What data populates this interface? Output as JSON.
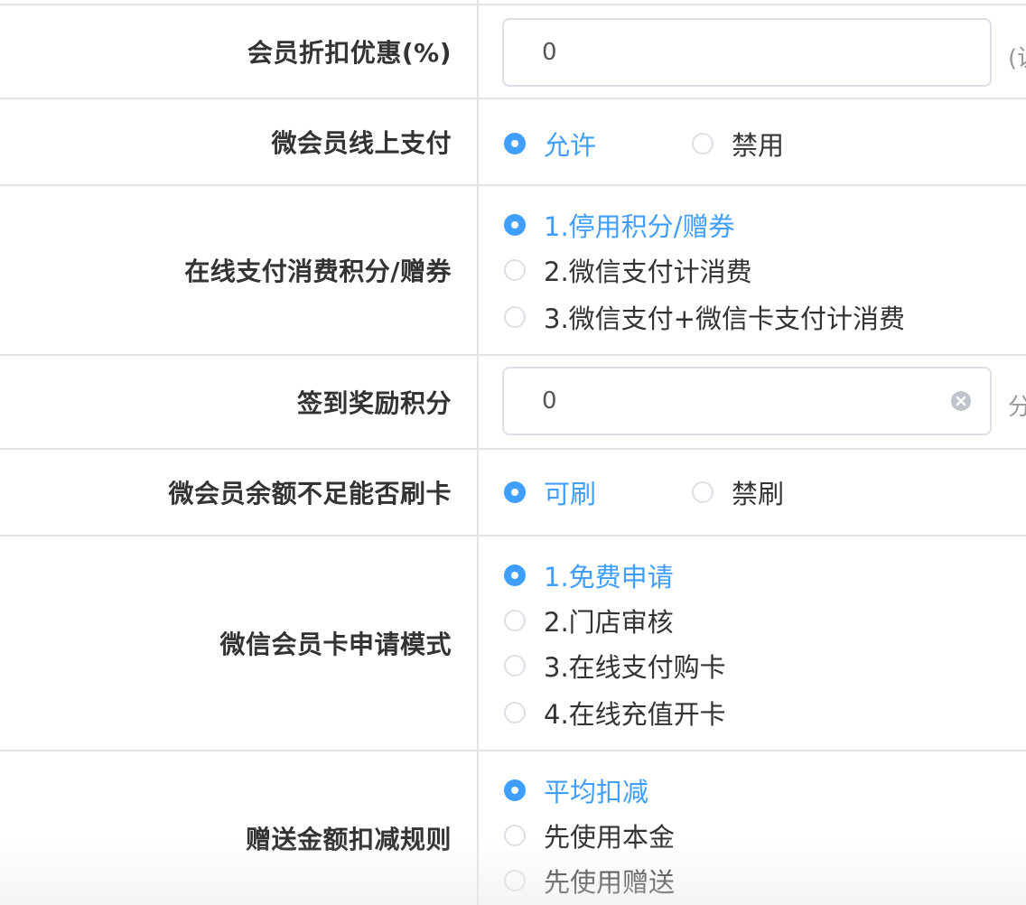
{
  "rows": {
    "discount": {
      "label": "会员折扣优惠(%)",
      "value": "0",
      "suffix": "(说"
    },
    "online_pay": {
      "label": "微会员线上支付",
      "options": [
        "允许",
        "禁用"
      ],
      "selected": "允许"
    },
    "points_coupon": {
      "label": "在线支付消费积分/赠券",
      "options": [
        "1.停用积分/赠券",
        "2.微信支付计消费",
        "3.微信支付+微信卡支付计消费"
      ],
      "selected": "1.停用积分/赠券"
    },
    "checkin": {
      "label": "签到奖励积分",
      "value": "0",
      "suffix": "分"
    },
    "insufficient_balance": {
      "label": "微会员余额不足能否刷卡",
      "options": [
        "可刷",
        "禁刷"
      ],
      "selected": "可刷"
    },
    "card_apply": {
      "label": "微信会员卡申请模式",
      "options": [
        "1.免费申请",
        "2.门店审核",
        "3.在线支付购卡",
        "4.在线充值开卡"
      ],
      "selected": "1.免费申请"
    },
    "gift_deduct": {
      "label": "赠送金额扣减规则",
      "options": [
        "平均扣减",
        "先使用本金",
        "先使用赠送"
      ],
      "selected": "平均扣减"
    }
  },
  "colors": {
    "accent": "#409eff",
    "label_text": "#333333",
    "border": "#e2e2e2"
  },
  "icons": {
    "clear": "circle-x-icon"
  }
}
